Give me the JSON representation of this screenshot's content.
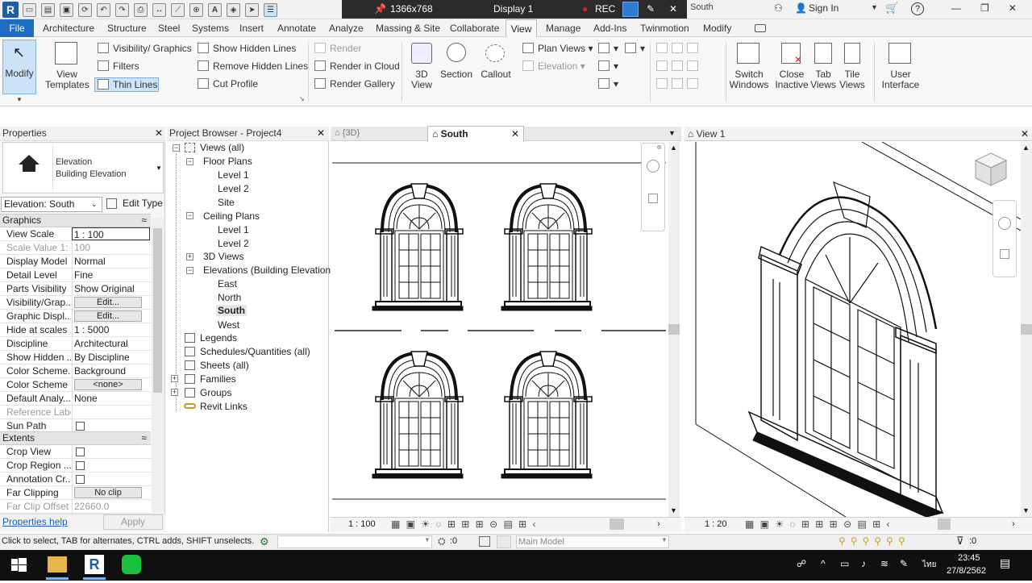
{
  "titlebar": {
    "rec_resolution": "1366x768",
    "display": "Display 1",
    "rec_label": "REC",
    "doc_title_fragment": "South",
    "sign_in": "Sign In",
    "help_icon": "?"
  },
  "tabs": [
    "File",
    "Architecture",
    "Structure",
    "Steel",
    "Systems",
    "Insert",
    "Annotate",
    "Analyze",
    "Massing & Site",
    "Collaborate",
    "View",
    "Manage",
    "Add-Ins",
    "Twinmotion",
    "Modify"
  ],
  "ribbon": {
    "modify": "Modify",
    "view_templates": [
      "View",
      "Templates"
    ],
    "visibility_graphics": "Visibility/ Graphics",
    "filters": "Filters",
    "thin_lines": "Thin  Lines",
    "show_hidden_lines": "Show  Hidden  Lines",
    "remove_hidden_lines": "Remove  Hidden  Lines",
    "cut_profile": "Cut  Profile",
    "render": "Render",
    "render_in_cloud": "Render  in  Cloud",
    "render_gallery": "Render  Gallery",
    "view_3d": [
      "3D",
      "View"
    ],
    "section": "Section",
    "callout": "Callout",
    "plan_views": "Plan  Views",
    "elevation": "Elevation",
    "switch_windows": [
      "Switch",
      "Windows"
    ],
    "close_inactive": [
      "Close",
      "Inactive"
    ],
    "tab_views": [
      "Tab",
      "Views"
    ],
    "tile_views": [
      "Tile",
      "Views"
    ],
    "user_interface": [
      "User",
      "Interface"
    ]
  },
  "properties": {
    "title": "Properties",
    "type_name": "Elevation",
    "type_sub": "Building Elevation",
    "selector": "Elevation: South",
    "edit_type": "Edit Type",
    "groups": {
      "graphics": "Graphics",
      "extents": "Extents"
    },
    "graphics_rows": [
      {
        "k": "View Scale",
        "v": "1 : 100"
      },
      {
        "k": "Scale Value    1:",
        "v": "100"
      },
      {
        "k": "Display Model",
        "v": "Normal"
      },
      {
        "k": "Detail Level",
        "v": "Fine"
      },
      {
        "k": "Parts Visibility",
        "v": "Show Original"
      },
      {
        "k": "Visibility/Grap...",
        "v": "Edit..."
      },
      {
        "k": "Graphic Displ...",
        "v": "Edit..."
      },
      {
        "k": "Hide at scales ...",
        "v": "1 : 5000"
      },
      {
        "k": "Discipline",
        "v": "Architectural"
      },
      {
        "k": "Show Hidden ...",
        "v": "By Discipline"
      },
      {
        "k": "Color Scheme...",
        "v": "Background"
      },
      {
        "k": "Color Scheme",
        "v": "<none>"
      },
      {
        "k": "Default Analy...",
        "v": "None"
      },
      {
        "k": "Reference Label",
        "v": ""
      },
      {
        "k": "Sun Path",
        "v": ""
      }
    ],
    "extents_rows": [
      {
        "k": "Crop View",
        "v": ""
      },
      {
        "k": "Crop Region ...",
        "v": ""
      },
      {
        "k": "Annotation Cr...",
        "v": ""
      },
      {
        "k": "Far Clipping",
        "v": "No clip"
      },
      {
        "k": "Far Clip Offset",
        "v": "22660.0"
      }
    ],
    "help": "Properties help",
    "apply": "Apply"
  },
  "browser": {
    "title": "Project Browser - Project4",
    "views_all": "Views (all)",
    "floor_plans": "Floor Plans",
    "fp_items": [
      "Level 1",
      "Level 2",
      "Site"
    ],
    "ceiling_plans": "Ceiling Plans",
    "cp_items": [
      "Level 1",
      "Level 2"
    ],
    "views_3d": "3D Views",
    "elevations": "Elevations (Building Elevation)",
    "elev_items": [
      "East",
      "North",
      "South",
      "West"
    ],
    "legends": "Legends",
    "schedules": "Schedules/Quantities (all)",
    "sheets": "Sheets (all)",
    "families": "Families",
    "groups": "Groups",
    "revit_links": "Revit Links"
  },
  "views": {
    "tab_3d": "{3D}",
    "tab_south": "South",
    "tab_view1": "View 1",
    "scale_left": "1 : 100",
    "scale_right": "1 : 20"
  },
  "statusbar": {
    "message": "Click to select, TAB for alternates, CTRL adds, SHIFT unselects.",
    "count": ":0",
    "model": "Main Model",
    "filter_count": ":0"
  },
  "taskbar": {
    "time": "23:45",
    "date": "27/8/2562",
    "lang": "ไทย"
  }
}
